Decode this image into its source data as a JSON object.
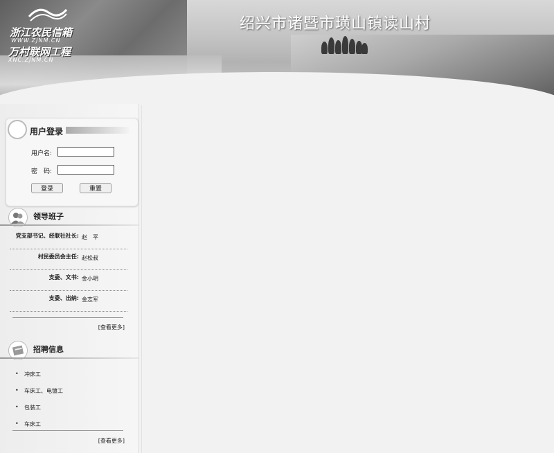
{
  "header": {
    "logo_line1": "浙江农民信箱",
    "logo_url1": "WWW.ZJNM.CN",
    "logo_line2": "万村联网工程",
    "logo_url2": "XNC.ZJNM.CN",
    "village_name": "绍兴市诸暨市璜山镇读山村"
  },
  "login": {
    "title": "用户登录",
    "username_label": "用户名:",
    "password_label": "密　码:",
    "username_value": "",
    "password_value": "",
    "login_button": "登录",
    "reset_button": "重置"
  },
  "leadership": {
    "title": "领导班子",
    "members": [
      {
        "role": "党支部书记、经联社社长:",
        "name": "赵　平"
      },
      {
        "role": "村民委员会主任:",
        "name": "赵松叔"
      },
      {
        "role": "支委、文书:",
        "name": "金小明"
      },
      {
        "role": "支委、出纳:",
        "name": "金志军"
      }
    ],
    "more": "[查看更多]"
  },
  "jobs": {
    "title": "招聘信息",
    "items": [
      "冲床工",
      "车床工、电镀工",
      "包装工",
      "车床工"
    ],
    "more": "[查看更多]"
  },
  "colors": {
    "page_bg": "#f2f2f2",
    "sidebar_bg": "#ededed",
    "text": "#222222"
  }
}
